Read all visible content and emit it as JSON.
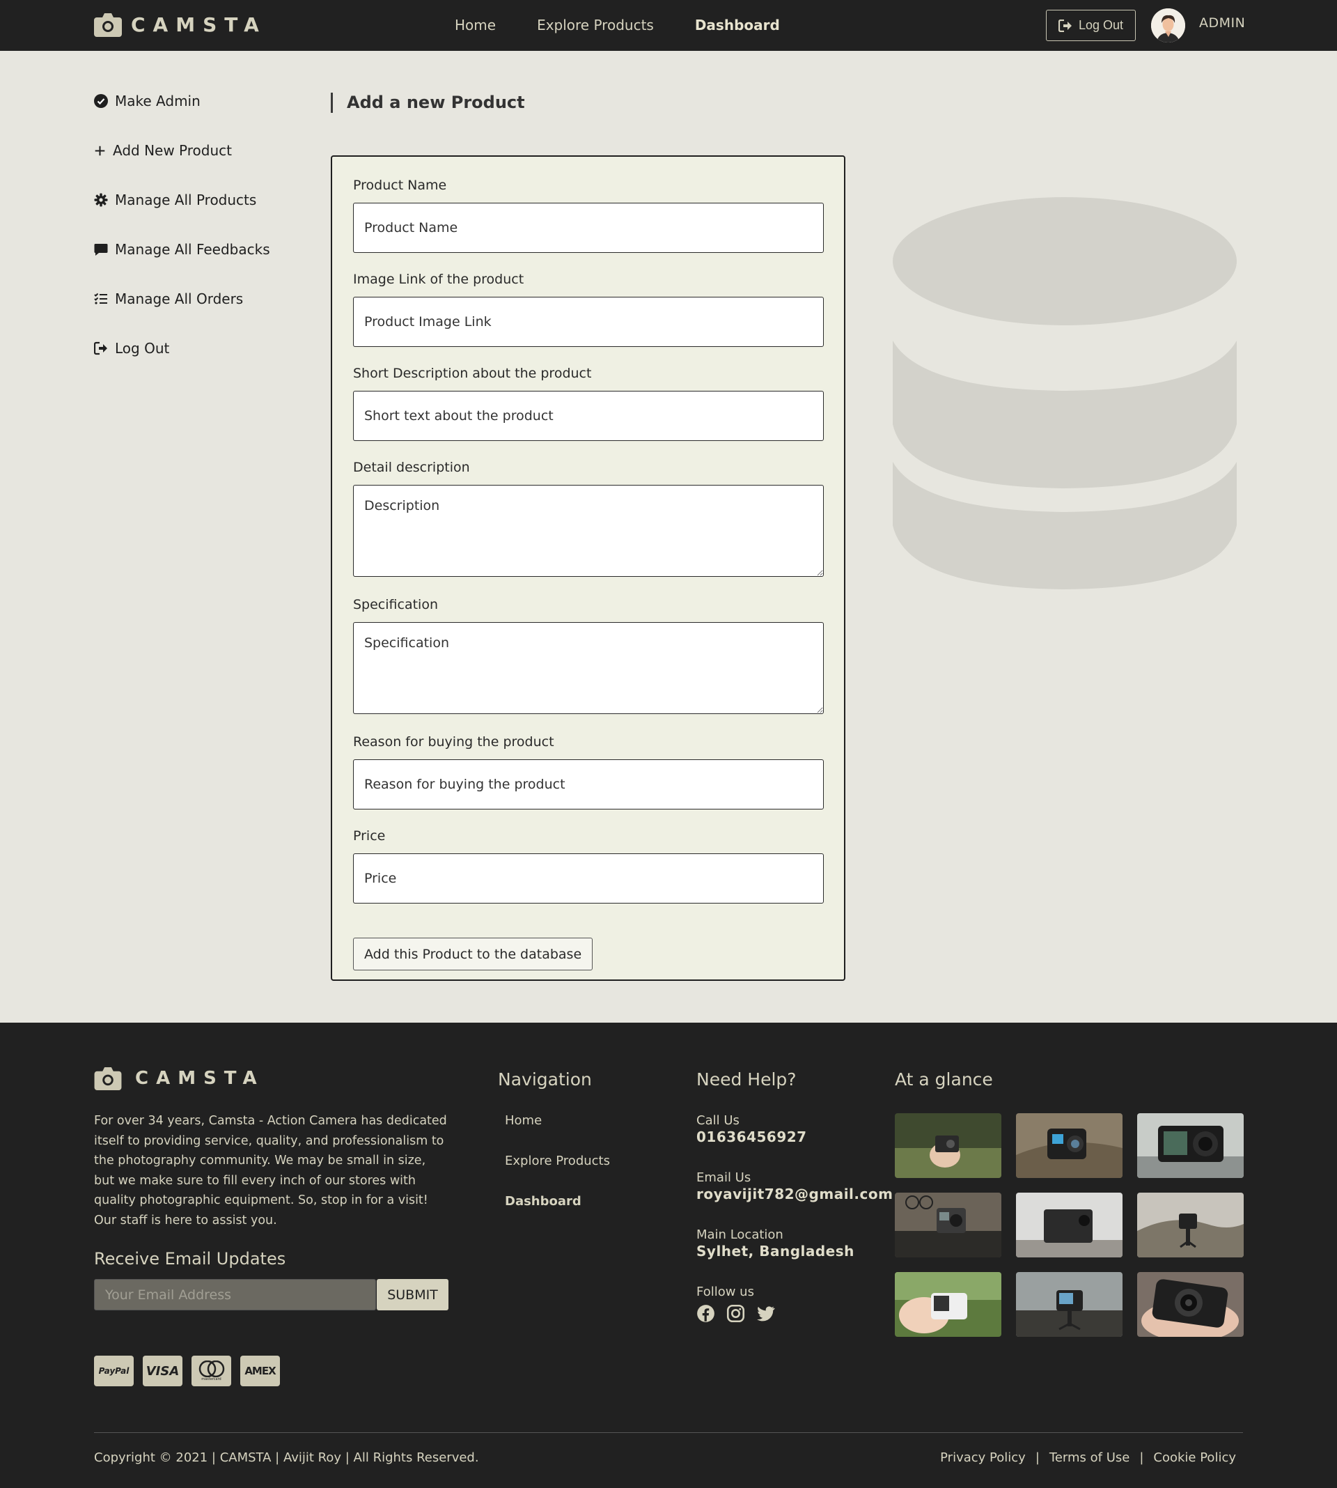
{
  "header": {
    "brand": "CAMSTA",
    "nav": [
      "Home",
      "Explore Products",
      "Dashboard"
    ],
    "logout_label": "Log Out",
    "user_name": "ADMIN"
  },
  "sidebar": {
    "items": [
      {
        "label": "Make Admin",
        "icon": "check-circle-icon"
      },
      {
        "label": "Add New Product",
        "icon": "plus-icon"
      },
      {
        "label": "Manage All Products",
        "icon": "gear-icon"
      },
      {
        "label": "Manage All Feedbacks",
        "icon": "comment-icon"
      },
      {
        "label": "Manage All Orders",
        "icon": "tasks-icon"
      },
      {
        "label": "Log Out",
        "icon": "logout-icon"
      }
    ]
  },
  "form": {
    "title": "Add a new Product",
    "fields": {
      "name": {
        "label": "Product Name",
        "placeholder": "Product Name"
      },
      "image": {
        "label": "Image Link of the product",
        "placeholder": "Product Image Link"
      },
      "short": {
        "label": "Short Description about the product",
        "placeholder": "Short text about the product"
      },
      "detail": {
        "label": "Detail description",
        "placeholder": "Description"
      },
      "spec": {
        "label": "Specification",
        "placeholder": "Specification"
      },
      "reason": {
        "label": "Reason for buying the product",
        "placeholder": "Reason for buying the product"
      },
      "price": {
        "label": "Price",
        "placeholder": "Price"
      }
    },
    "submit_label": "Add this Product to the database"
  },
  "footer": {
    "brand": "CAMSTA",
    "about": "For over 34 years, Camsta - Action Camera has dedicated itself to providing service, quality, and professionalism to the photography community. We may be small in size, but we make sure to fill every inch of our stores with quality photographic equipment. So, stop in for a visit! Our staff is here to assist you.",
    "updates_title": "Receive Email Updates",
    "email_placeholder": "Your Email Address",
    "submit_label": "SUBMIT",
    "navigation_title": "Navigation",
    "nav": [
      "Home",
      "Explore Products",
      "Dashboard"
    ],
    "help_title": "Need Help?",
    "call_label": "Call Us",
    "call_value": "01636456927",
    "email_label": "Email Us",
    "email_value": "royavijit782@gmail.com",
    "location_label": "Main Location",
    "location_value": "Sylhet, Bangladesh",
    "follow_label": "Follow us",
    "glance_title": "At a glance",
    "payments": [
      "PayPal",
      "VISA",
      "mastercard",
      "AMEX"
    ],
    "copyright": "Copyright © 2021 | CAMSTA | Avijit Roy | All Rights Reserved.",
    "legal": [
      "Privacy Policy",
      "Terms of Use",
      "Cookie Policy"
    ]
  },
  "colors": {
    "dark": "#212121",
    "accent": "#d6d3bf",
    "page_bg": "#e7e6df",
    "form_bg": "#eff0e3"
  }
}
